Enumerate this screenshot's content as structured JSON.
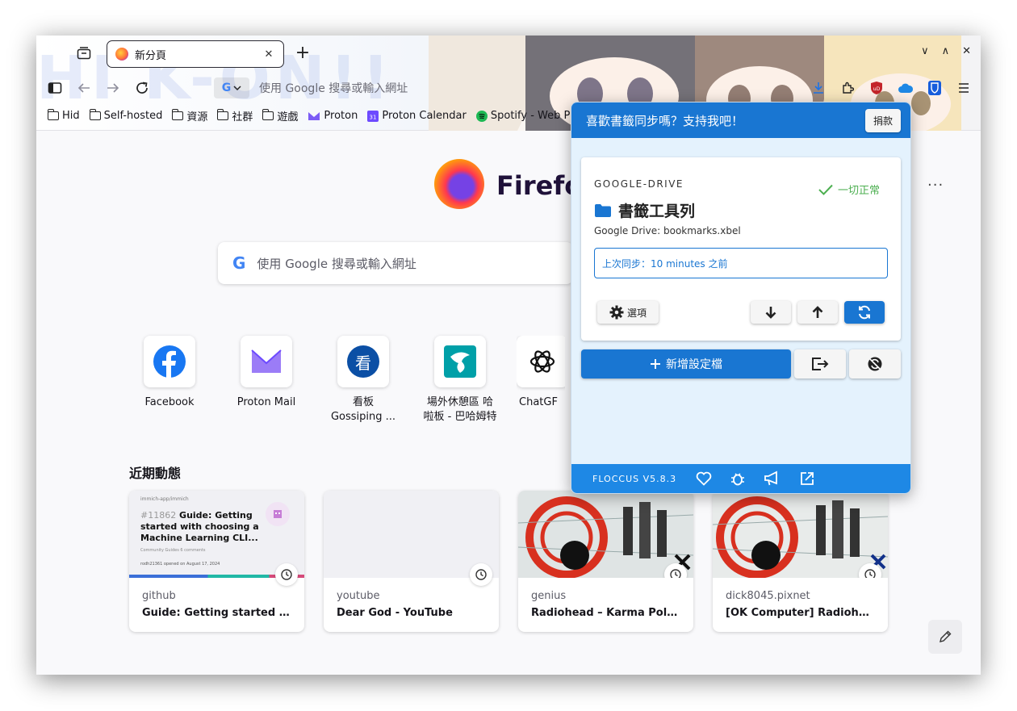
{
  "tab": {
    "title": "新分頁",
    "close_glyph": "✕",
    "new_glyph": "+"
  },
  "window_controls": {
    "minimize": "∨",
    "maximize": "∧",
    "close": "✕"
  },
  "decoration": {
    "text": "HI K-ON!!"
  },
  "urlbar": {
    "placeholder": "使用 Google 搜尋或輸入網址",
    "engine_letter": "G"
  },
  "bookmarks": [
    {
      "label": "Hid",
      "icon": "folder-icon"
    },
    {
      "label": "Self-hosted",
      "icon": "folder-icon"
    },
    {
      "label": "資源",
      "icon": "folder-icon"
    },
    {
      "label": "社群",
      "icon": "folder-icon"
    },
    {
      "label": "遊戲",
      "icon": "folder-icon"
    },
    {
      "label": "Proton",
      "icon": "proton-icon"
    },
    {
      "label": "Proton Calendar",
      "icon": "calendar-icon"
    },
    {
      "label": "Spotify - Web P",
      "icon": "spotify-icon"
    }
  ],
  "newtab": {
    "brand": "Firefox",
    "more_glyph": "···",
    "search_placeholder": "使用 Google 搜尋或輸入網址",
    "search_logo": "G",
    "shortcuts": [
      {
        "label": "Facebook",
        "icon": "facebook-icon"
      },
      {
        "label": "Proton Mail",
        "icon": "proton-mail-icon"
      },
      {
        "label": "看板\nGossiping ...",
        "line1": "看板",
        "line2": "Gossiping ...",
        "icon_text": "看"
      },
      {
        "label": "場外休憩區 哈啦板 - 巴哈姆特",
        "line1": "場外休憩區 哈",
        "line2": "啦板 - 巴哈姆特",
        "icon": "bahamut-icon"
      },
      {
        "label": "ChatGPT",
        "line1": "ChatGF",
        "icon": "openai-icon"
      }
    ],
    "recent_title": "近期動態",
    "recent": [
      {
        "site": "github",
        "title": "Guide: Getting started with..."
      },
      {
        "site": "youtube",
        "title": "Dear God - YouTube"
      },
      {
        "site": "genius",
        "title": "Radiohead – Karma Police L..."
      },
      {
        "site": "dick8045.pixnet",
        "title": "[OK Computer] Radiohead -..."
      }
    ],
    "github_thumb": {
      "repo": "immich-app/immich",
      "issue_num": "#11862",
      "issue_title": " Guide: Getting started with choosing a Machine Learning CLI...",
      "meta": "Community Guides   6 comments",
      "author": "rodh21361 opened on August 17, 2024"
    }
  },
  "floccus": {
    "banner": "喜歡書籤同步嗎？支持我吧！",
    "donate": "捐款",
    "account_type": "GOOGLE-DRIVE",
    "status": "一切正常",
    "account_name": "書籤工具列",
    "account_sub": "Google Drive: bookmarks.xbel",
    "last_sync": "上次同步：10 minutes 之前",
    "options": "選項",
    "new_profile": "新增設定檔",
    "version": "FLOCCUS V5.8.3",
    "colors": {
      "primary": "#1976d2",
      "success": "#4caf50",
      "background": "#e4f2fd"
    }
  }
}
